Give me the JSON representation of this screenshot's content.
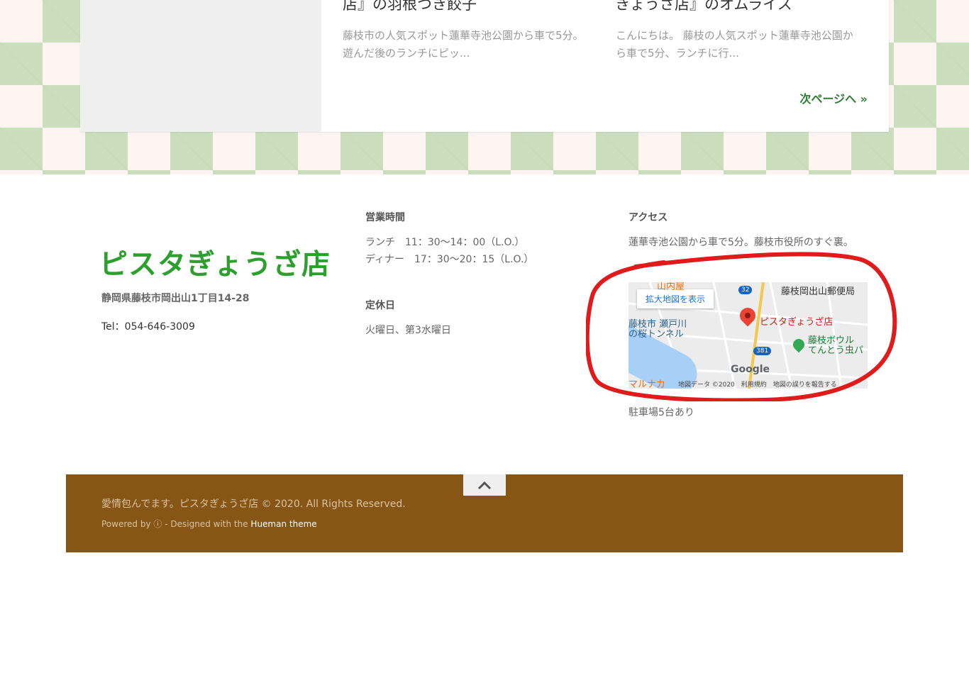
{
  "posts": [
    {
      "title": "店』の羽根つき餃子",
      "excerpt": "藤枝市の人気スポット蓮華寺池公園から車で5分。遊んだ後のランチにピッ..."
    },
    {
      "title": "ぎょうざ店』のオムライス",
      "excerpt": "こんにちは。 藤枝の人気スポット蓮華寺池公園から車で5分、ランチに行..."
    }
  ],
  "next_page": "次ページへ »",
  "footer": {
    "logo": "ピスタぎょうざ店",
    "address": "静岡県藤枝市岡出山1丁目14-28",
    "tel": "Tel：054-646-3009",
    "hours_heading": "営業時間",
    "lunch": "ランチ　11：30〜14：00（L.O.）",
    "dinner": "ディナー　17：30〜20：15（L.O.）",
    "closed_heading": "定休日",
    "closed": "火曜日、第3水曜日",
    "access_heading": "アクセス",
    "access_text": "蓮華寺池公園から車で5分。藤枝市役所のすぐ裏。",
    "parking": "駐車場5台あり"
  },
  "map": {
    "enlarge_button": "拡大地図を表示",
    "store_label": "ピスタぎょうざ店",
    "post_office": "藤枝岡出山郵便局",
    "top_label": "山内屋",
    "tunnel": "藤枝市 瀬戸川\nの桜トンネル",
    "bowl": "藤枝ボウル\nてんとう虫パ",
    "bottom_left": "マルナカ",
    "road_32": "32",
    "road_381": "381",
    "google": "Google",
    "attribution": "地図データ ©2020　利用規約　地図の誤りを報告する"
  },
  "bottom": {
    "copyright": "愛情包んでます。ピスタぎょうざ店 © 2020. All Rights Reserved.",
    "powered_prefix": "Powered by",
    "designed": "- Designed with the",
    "theme_link": "Hueman theme"
  },
  "colors": {
    "footer_bg": "#875515",
    "logo": "#2ca02c",
    "annotation": "#e01b1b"
  }
}
